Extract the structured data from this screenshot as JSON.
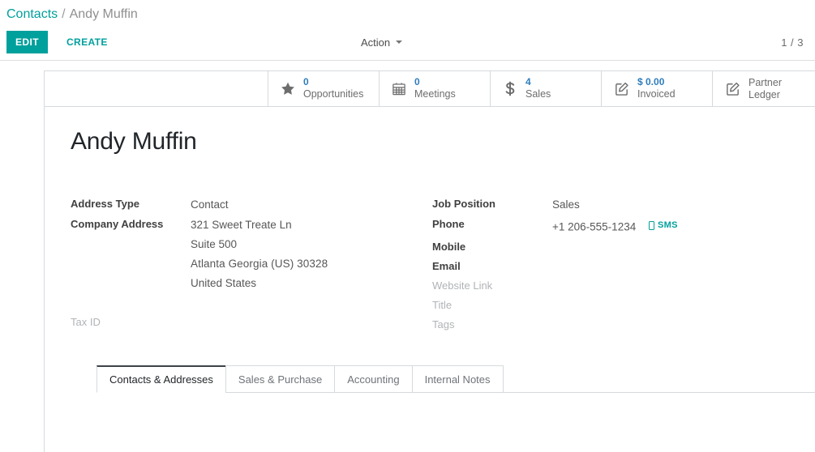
{
  "breadcrumb": {
    "root": "Contacts",
    "separator": "/",
    "current": "Andy Muffin"
  },
  "control_panel": {
    "edit_label": "EDIT",
    "create_label": "CREATE",
    "action_label": "Action",
    "pager": "1 / 3"
  },
  "stat_buttons": [
    {
      "icon": "star-icon",
      "value": "0",
      "label": "Opportunities"
    },
    {
      "icon": "calendar-icon",
      "value": "0",
      "label": "Meetings"
    },
    {
      "icon": "dollar-sign-icon",
      "value": "4",
      "label": "Sales"
    },
    {
      "icon": "pencil-square-icon",
      "value": "$ 0.00",
      "label": "Invoiced"
    },
    {
      "icon": "pencil-square-icon",
      "value": "",
      "label": "Partner Ledger"
    }
  ],
  "record": {
    "title": "Andy Muffin"
  },
  "fields_left": [
    {
      "label": "Address Type",
      "value": "Contact",
      "muted": false
    },
    {
      "label": "Company Address",
      "value": "",
      "muted": false
    },
    {
      "label": "Tax ID",
      "value": "",
      "muted": true
    }
  ],
  "address": {
    "street": "321 Sweet Treate Ln",
    "street2": "Suite 500",
    "city_state_zip": "Atlanta  Georgia (US)  30328",
    "country": "United States"
  },
  "fields_right": [
    {
      "label": "Job Position",
      "value": "Sales",
      "muted": false
    },
    {
      "label": "Phone",
      "value": "+1 206-555-1234",
      "muted": false
    },
    {
      "label": "Mobile",
      "value": "",
      "muted": false
    },
    {
      "label": "Email",
      "value": "",
      "muted": false
    },
    {
      "label": "Website Link",
      "value": "",
      "muted": true
    },
    {
      "label": "Title",
      "value": "",
      "muted": true
    },
    {
      "label": "Tags",
      "value": "",
      "muted": true
    }
  ],
  "sms": {
    "label": "SMS"
  },
  "tabs": [
    {
      "label": "Contacts & Addresses",
      "active": true
    },
    {
      "label": "Sales & Purchase",
      "active": false
    },
    {
      "label": "Accounting",
      "active": false
    },
    {
      "label": "Internal Notes",
      "active": false
    }
  ],
  "colors": {
    "brand_teal": "#00a09d",
    "stat_value_blue": "#2e7dbb",
    "border_gray": "#d6dadd",
    "muted_text": "#b0b3b6"
  }
}
